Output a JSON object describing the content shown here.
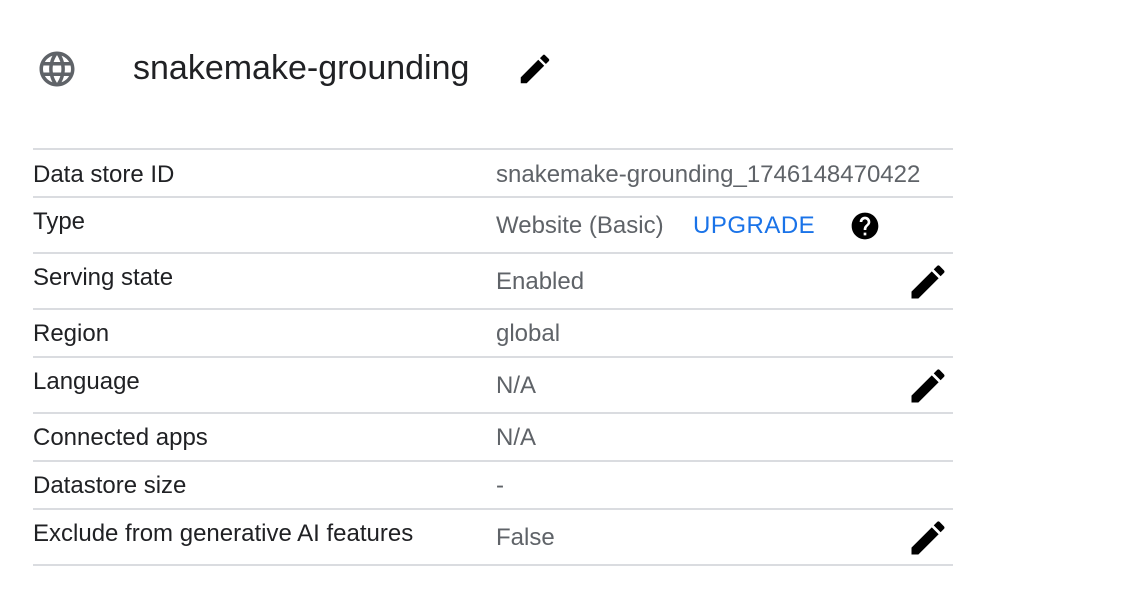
{
  "header": {
    "title": "snakemake-grounding",
    "globe_icon": "globe-icon",
    "edit_icon": "pencil-edit-icon"
  },
  "details": {
    "rows": [
      {
        "label": "Data store ID",
        "value": "snakemake-grounding_1746148470422"
      },
      {
        "label": "Type",
        "value": "Website (Basic)",
        "action": "UPGRADE",
        "help_icon": "help-circle-icon"
      },
      {
        "label": "Serving state",
        "value": "Enabled",
        "editable": true
      },
      {
        "label": "Region",
        "value": "global"
      },
      {
        "label": "Language",
        "value": "N/A",
        "editable": true
      },
      {
        "label": "Connected apps",
        "value": "N/A"
      },
      {
        "label": "Datastore size",
        "value": "-"
      },
      {
        "label": "Exclude from generative AI features",
        "value": "False",
        "editable": true
      }
    ]
  },
  "colors": {
    "text": "#202124",
    "secondary_text": "#5f6368",
    "link": "#1a73e8",
    "divider": "#dadce0",
    "icon": "#000000",
    "globe": "#5f6368"
  }
}
